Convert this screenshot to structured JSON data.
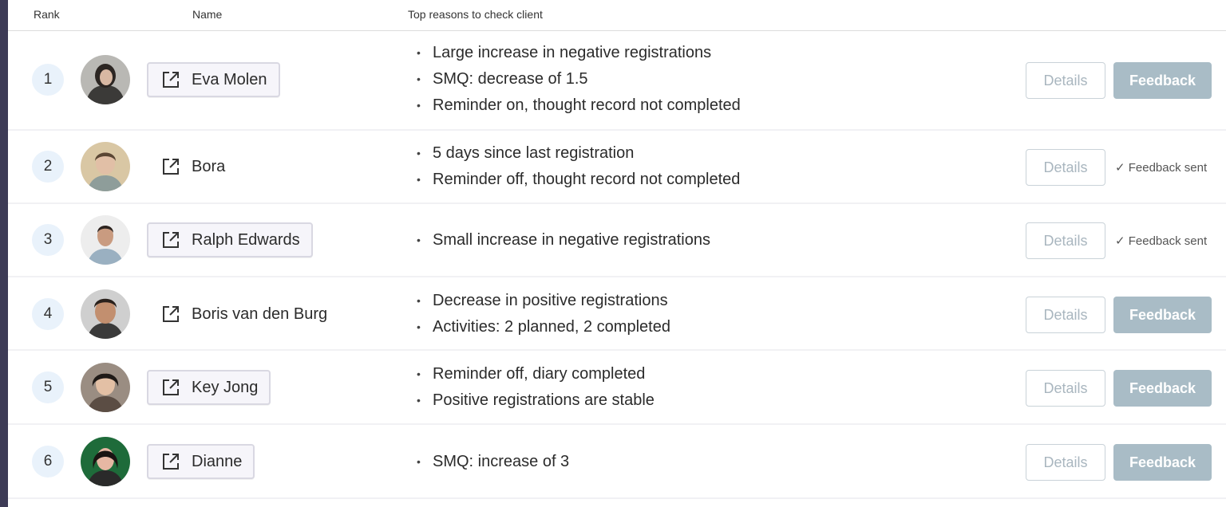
{
  "header": {
    "rank": "Rank",
    "name": "Name",
    "reasons": "Top reasons to check client"
  },
  "colors": {
    "rank_badge": "#e9f2fb",
    "feedback_button": "#a9bcc6",
    "details_border": "#c9d2d8",
    "frame": "#3d3b56"
  },
  "actions": {
    "details_label": "Details",
    "feedback_label": "Feedback",
    "sent_label": "✓ Feedback sent"
  },
  "rows": [
    {
      "rank": "1",
      "name": "Eva Molen",
      "reasons": [
        "Large increase in negative registrations",
        "SMQ: decrease of 1.5",
        "Reminder on, thought record not completed"
      ],
      "status": "feedback"
    },
    {
      "rank": "2",
      "name": "Bora",
      "reasons": [
        "5 days since last registration",
        "Reminder off, thought record not completed"
      ],
      "status": "sent"
    },
    {
      "rank": "3",
      "name": "Ralph Edwards",
      "reasons": [
        "Small increase in negative registrations"
      ],
      "status": "sent"
    },
    {
      "rank": "4",
      "name": "Boris van den Burg",
      "reasons": [
        "Decrease in positive registrations",
        "Activities: 2 planned, 2 completed"
      ],
      "status": "feedback"
    },
    {
      "rank": "5",
      "name": "Key Jong",
      "reasons": [
        "Reminder off, diary completed",
        "Positive registrations are stable"
      ],
      "status": "feedback"
    },
    {
      "rank": "6",
      "name": "Dianne",
      "reasons": [
        "SMQ: increase of 3"
      ],
      "status": "feedback"
    }
  ]
}
